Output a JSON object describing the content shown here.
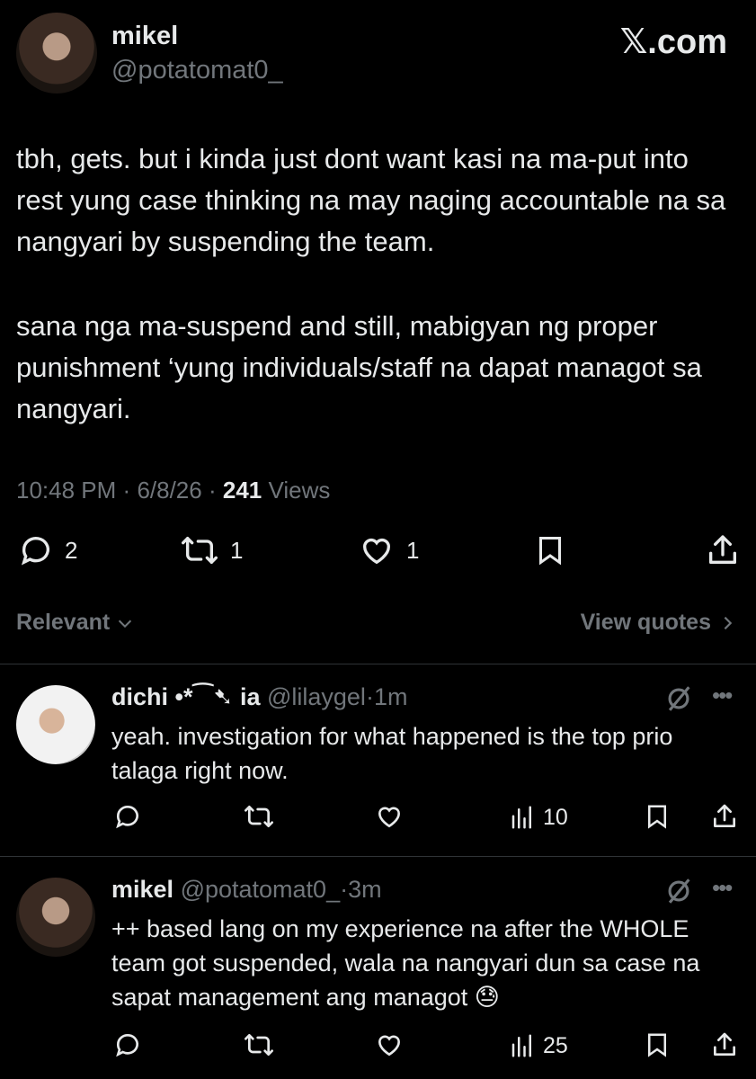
{
  "brand": {
    "watermark": "𝕏.com"
  },
  "main_tweet": {
    "author_name": "mikel",
    "author_handle": "@potatomat0_",
    "text_p1": "tbh, gets. but i kinda just dont want kasi na ma-put into rest yung case thinking na may naging accountable na sa nangyari by suspending the team.",
    "text_p2": "sana nga ma-suspend and still, mabigyan ng proper punishment ‘yung individuals/staff na dapat managot sa nangyari.",
    "time": "10:48 PM",
    "date": "6/8/26",
    "views_count": "241",
    "views_label": "Views",
    "sep": "·",
    "replies": "2",
    "reposts": "1",
    "likes": "1",
    "icons": [
      "reply-icon",
      "repost-icon",
      "like-icon",
      "bookmark-icon",
      "share-icon"
    ]
  },
  "filter": {
    "sort_label": "Relevant",
    "quotes_label": "View quotes"
  },
  "replies": [
    {
      "name": "dichi •*⁀➷ ia",
      "handle": "@lilaygel",
      "time": "1m",
      "text": "yeah. investigation for what happened is the top prio talaga right now.",
      "views": "10"
    },
    {
      "name": "mikel",
      "handle": "@potatomat0_",
      "time": "3m",
      "text": "++ based lang on my experience na after the WHOLE team got suspended, wala na nangyari dun sa case na sapat management ang managot 😓",
      "views": "25"
    }
  ],
  "colors": {
    "background": "#000000",
    "text": "#e7e9ea",
    "muted": "#71767b",
    "divider": "#2f3336"
  }
}
